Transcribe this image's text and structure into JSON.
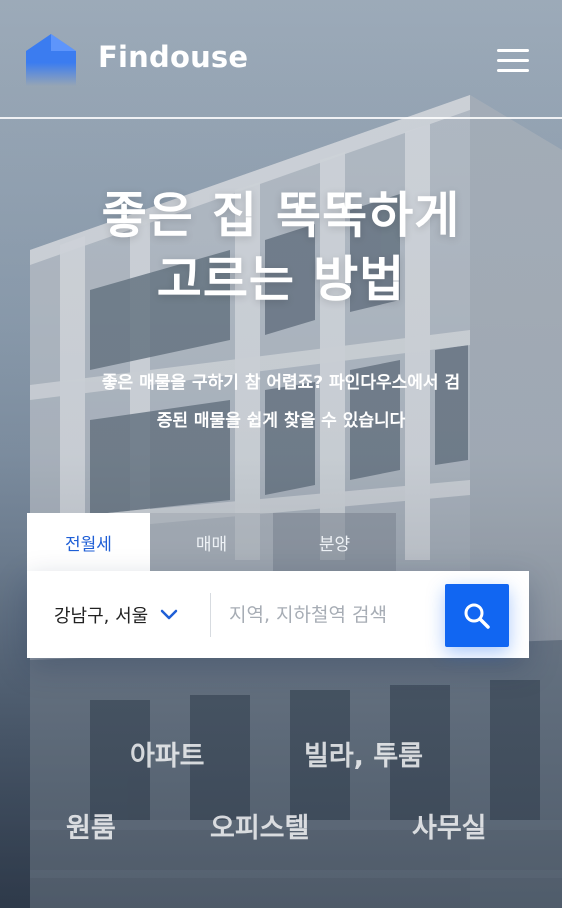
{
  "header": {
    "brand": "Findouse",
    "logo_icon": "house-logo-icon",
    "menu_icon": "hamburger-menu-icon"
  },
  "hero": {
    "title_line1": "좋은 집 똑똑하게",
    "title_line2": "고르는 방법",
    "subtitle_line1": "좋은 매물을 구하기 참 어렵죠? 파인다우스에서 검",
    "subtitle_line2": "증된 매물을 쉽게 찾을 수 있습니다"
  },
  "tabs": [
    {
      "label": "전월세",
      "active": true
    },
    {
      "label": "매매",
      "active": false
    },
    {
      "label": "분양",
      "active": false
    }
  ],
  "search": {
    "region_value": "강남구, 서울",
    "region_icon": "chevron-down-icon",
    "placeholder": "지역, 지하철역 검색",
    "button_icon": "search-icon"
  },
  "categories": [
    "아파트",
    "빌라, 투룸",
    "원룸",
    "오피스텔",
    "사무실"
  ],
  "colors": {
    "accent": "#1166f2",
    "active_tab_text": "#1f5fd6",
    "text_light": "#ffffff"
  }
}
